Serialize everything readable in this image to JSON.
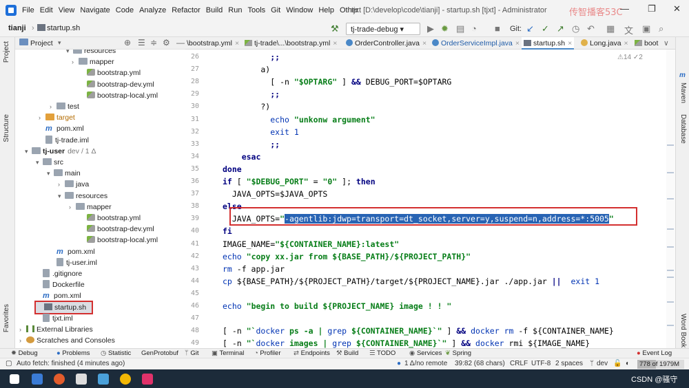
{
  "window": {
    "title": "tjxt [D:\\develop\\code\\tianji] - startup.sh [tjxt] - Administrator",
    "watermark": "传智播客53C",
    "controls": [
      "—",
      "❐",
      "✕"
    ]
  },
  "menu": [
    "File",
    "Edit",
    "View",
    "Navigate",
    "Code",
    "Analyze",
    "Refactor",
    "Build",
    "Run",
    "Tools",
    "Git",
    "Window",
    "Help",
    "Other"
  ],
  "breadcrumb": {
    "project": "tianji",
    "file": "startup.sh"
  },
  "toolbar": {
    "run_config": "tj-trade-debug",
    "git_label": "Git:"
  },
  "left_strip": {
    "project": "Project",
    "structure": "Structure",
    "favorites": "Favorites"
  },
  "right_strip": {
    "maven": "Maven",
    "database": "Database",
    "word_book": "Word Book",
    "m_icon": "m"
  },
  "project_panel": {
    "title": "Project",
    "tree": [
      {
        "label": "resources",
        "type": "folder",
        "arrow": "▾"
      },
      {
        "label": "mapper",
        "type": "folder",
        "arrow": "›"
      },
      {
        "label": "bootstrap.yml",
        "type": "yml"
      },
      {
        "label": "bootstrap-dev.yml",
        "type": "yml"
      },
      {
        "label": "bootstrap-local.yml",
        "type": "yml"
      },
      {
        "label": "test",
        "type": "folder",
        "arrow": "›"
      },
      {
        "label": "target",
        "type": "folder-orange",
        "arrow": "›"
      },
      {
        "label": "pom.xml",
        "type": "maven"
      },
      {
        "label": "tj-trade.iml",
        "type": "file"
      },
      {
        "label": "tj-user",
        "type": "module",
        "arrow": "▾",
        "branch": "dev / 1 Δ"
      },
      {
        "label": "src",
        "type": "folder",
        "arrow": "▾"
      },
      {
        "label": "main",
        "type": "folder",
        "arrow": "▾"
      },
      {
        "label": "java",
        "type": "folder",
        "arrow": "›"
      },
      {
        "label": "resources",
        "type": "folder",
        "arrow": "▾"
      },
      {
        "label": "mapper",
        "type": "folder",
        "arrow": "›"
      },
      {
        "label": "bootstrap.yml",
        "type": "yml"
      },
      {
        "label": "bootstrap-dev.yml",
        "type": "yml"
      },
      {
        "label": "bootstrap-local.yml",
        "type": "yml"
      },
      {
        "label": "pom.xml",
        "type": "maven"
      },
      {
        "label": "tj-user.iml",
        "type": "file"
      },
      {
        "label": ".gitignore",
        "type": "file"
      },
      {
        "label": "Dockerfile",
        "type": "file"
      },
      {
        "label": "pom.xml",
        "type": "maven"
      },
      {
        "label": "startup.sh",
        "type": "term"
      },
      {
        "label": "tjxt.iml",
        "type": "file"
      },
      {
        "label": "External Libraries",
        "type": "lib",
        "arrow": "›"
      },
      {
        "label": "Scratches and Consoles",
        "type": "scratch",
        "arrow": "›"
      }
    ]
  },
  "editor_tabs": [
    {
      "label": "\\bootstrap.yml"
    },
    {
      "label": "tj-trade\\...\\bootstrap.yml"
    },
    {
      "label": "OrderController.java"
    },
    {
      "label": "OrderServiceImpl.java"
    },
    {
      "label": "startup.sh",
      "active": true
    },
    {
      "label": "Long.java"
    },
    {
      "label": "boot"
    }
  ],
  "inspection": "⚠14 ✓2",
  "code_lines": [
    {
      "n": "26",
      "html": "          <span class='kw'>;;</span>"
    },
    {
      "n": "27",
      "html": "        a)"
    },
    {
      "n": "28",
      "html": "          [ -n <span class='str'>\"$OPTARG\"</span> ] <span class='kw'>&amp;&amp;</span> DEBUG_PORT=$OPTARG"
    },
    {
      "n": "29",
      "html": "          <span class='kw'>;;</span>"
    },
    {
      "n": "30",
      "html": "        ?)"
    },
    {
      "n": "31",
      "html": "          <span class='cmd'>echo</span> <span class='str'>\"unkonw argument\"</span>"
    },
    {
      "n": "32",
      "html": "          <span class='cmd'>exit</span> <span class='cmd'>1</span>"
    },
    {
      "n": "33",
      "html": "          <span class='kw'>;;</span>"
    },
    {
      "n": "34",
      "html": "    <span class='kw'>esac</span>"
    },
    {
      "n": "35",
      "html": "<span class='kw'>done</span>"
    },
    {
      "n": "36",
      "html": "<span class='kw'>if</span> [ <span class='str'>\"$DEBUG_PORT\"</span> = <span class='str'>\"0\"</span> ]; <span class='kw'>then</span>"
    },
    {
      "n": "37",
      "html": "  JAVA_OPTS=$JAVA_OPTS"
    },
    {
      "n": "38",
      "html": "<span class='kw'>else</span>"
    },
    {
      "n": "39",
      "html": "  JAVA_OPTS=<span class='str'>\"</span><span class='sel'>-agentlib:jdwp=transport=dt_socket,server=y,suspend=n,address=*:5005</span><span class='str'>\"</span>"
    },
    {
      "n": "40",
      "html": "<span class='kw'>fi</span>"
    },
    {
      "n": "41",
      "html": "IMAGE_NAME=<span class='str'>\"${CONTAINER_NAME}:latest\"</span>"
    },
    {
      "n": "42",
      "html": "<span class='cmd'>echo</span> <span class='str'>\"copy xx.jar from ${BASE_PATH}/${PROJECT_PATH}\"</span>"
    },
    {
      "n": "43",
      "html": "<span class='cmd'>rm</span> -f app.jar"
    },
    {
      "n": "44",
      "html": "<span class='cmd'>cp</span> ${BASE_PATH}/${PROJECT_PATH}/target/${PROJECT_NAME}.jar ./app.jar <span class='kw'>||</span>  <span class='cmd'>exit</span> <span class='cmd'>1</span>"
    },
    {
      "n": "45",
      "html": ""
    },
    {
      "n": "46",
      "html": "<span class='cmd'>echo</span> <span class='str'>\"begin to build ${PROJECT_NAME} image ! ! \"</span>"
    },
    {
      "n": "47",
      "html": ""
    },
    {
      "n": "48",
      "html": "[ -n <span class='str'>\"`</span><span class='cmd'>docker</span><span class='str'> ps -a | </span><span class='cmd'>grep</span><span class='str'> ${CONTAINER_NAME}`\"</span> ] <span class='kw'>&amp;&amp;</span> <span class='cmd'>docker</span> <span class='cmd'>rm</span> -f ${CONTAINER_NAME}"
    },
    {
      "n": "49",
      "html": "[ -n <span class='str'>\"`</span><span class='cmd'>docker</span><span class='str'> images | </span><span class='cmd'>grep</span><span class='str'> ${CONTAINER_NAME}`\"</span> ] <span class='kw'>&amp;&amp;</span> <span class='cmd'>docker</span> rmi ${IMAGE_NAME}"
    }
  ],
  "tool_windows": [
    "Debug",
    "Problems",
    "Statistic",
    "GenProtobuf",
    "Git",
    "Terminal",
    "Profiler",
    "Endpoints",
    "Build",
    "TODO",
    "Services",
    "Spring"
  ],
  "event_log": "Event Log",
  "status": {
    "message": "Auto fetch: finished (4 minutes ago)",
    "vcs": "1 Δ/no remote",
    "position": "39:82 (68 chars)",
    "line_sep": "CRLF",
    "encoding": "UTF-8",
    "indent": "2 spaces",
    "branch": "dev",
    "memory": "778 of 1979M",
    "memory_fraction": 0.393
  },
  "taskbar": {
    "watermark": "CSDN @骚守"
  }
}
